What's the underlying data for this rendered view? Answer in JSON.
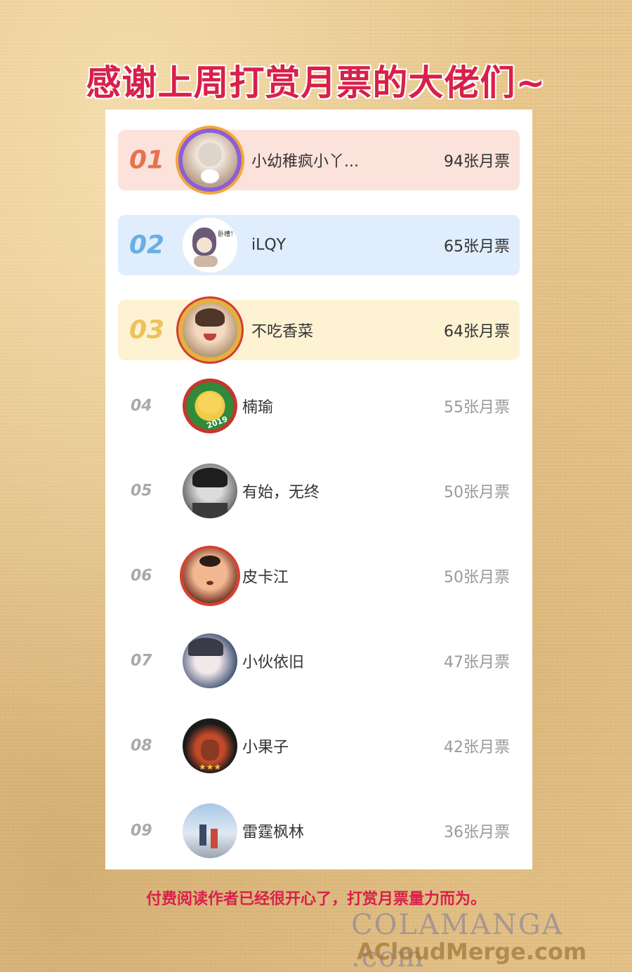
{
  "title": "感谢上周打赏月票的大佬们~",
  "ranking": [
    {
      "rank": "01",
      "name": "小幼稚疯小丫...",
      "votes": "94张月票"
    },
    {
      "rank": "02",
      "name": "iLQY",
      "votes": "65张月票"
    },
    {
      "rank": "03",
      "name": "不吃香菜",
      "votes": "64张月票"
    },
    {
      "rank": "04",
      "name": "楠瑜",
      "votes": "55张月票"
    },
    {
      "rank": "05",
      "name": "有始，无终",
      "votes": "50张月票"
    },
    {
      "rank": "06",
      "name": "皮卡江",
      "votes": "50张月票"
    },
    {
      "rank": "07",
      "name": "小伙依旧",
      "votes": "47张月票"
    },
    {
      "rank": "08",
      "name": "小果子",
      "votes": "42张月票"
    },
    {
      "rank": "09",
      "name": "雷霆枫林",
      "votes": "36张月票"
    }
  ],
  "avatar_badge_text": {
    "rank2": "卧槽！",
    "rank4": "2019"
  },
  "footer": "付费阅读作者已经很开心了，打赏月票量力而为。",
  "watermark": {
    "line1": "COLAMANGA .com",
    "line2": "ACloudMerge.com"
  },
  "colors": {
    "title": "#d8204a",
    "rank1": "#e8714f",
    "rank2": "#6aaee6",
    "rank3": "#eec25a",
    "rank_plain": "#a9a9a9"
  }
}
